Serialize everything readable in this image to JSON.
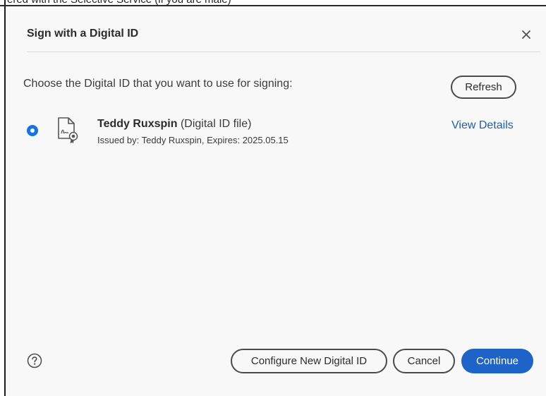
{
  "background": {
    "partial_text": "ered with the Selective Service (if you are male)"
  },
  "dialog": {
    "title": "Sign with a Digital ID",
    "close_icon": "close-icon",
    "instruction": "Choose the Digital ID that you want to use for signing:",
    "refresh_label": "Refresh",
    "digital_ids": [
      {
        "selected": true,
        "name": "Teddy Ruxspin",
        "type_label": "(Digital ID file)",
        "issued": "Issued by: Teddy Ruxspin, Expires: 2025.05.15",
        "view_details_label": "View Details",
        "icon": "certificate-icon"
      }
    ],
    "footer": {
      "help_icon": "help-icon",
      "configure_label": "Configure New Digital ID",
      "cancel_label": "Cancel",
      "continue_label": "Continue"
    }
  },
  "colors": {
    "accent": "#1e64c8",
    "radio": "#1473e6",
    "link": "#1e5fb0",
    "dialog_bg": "#f8f8f8"
  }
}
